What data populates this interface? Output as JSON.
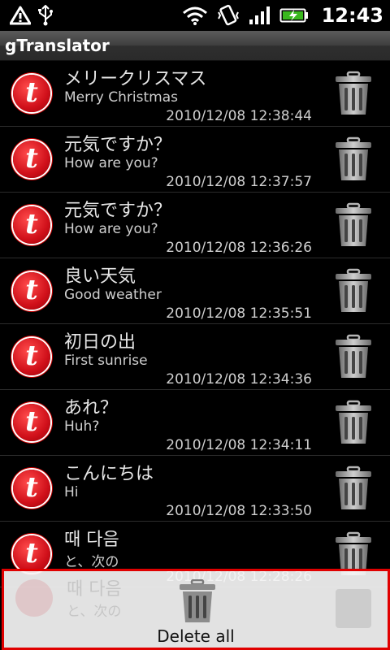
{
  "status_bar": {
    "time": "12:43",
    "icons": [
      "warning-icon",
      "usb-icon",
      "wifi-icon",
      "vibrate-icon",
      "signal-icon",
      "battery-charging-icon"
    ]
  },
  "app": {
    "title": "gTranslator"
  },
  "history": [
    {
      "source": "メリークリスマス",
      "translation": "Merry Christmas",
      "timestamp": "2010/12/08 12:38:44"
    },
    {
      "source": "元気ですか？",
      "translation": "How are you?",
      "timestamp": "2010/12/08 12:37:57"
    },
    {
      "source": "元気ですか？",
      "translation": "How are you?",
      "timestamp": "2010/12/08 12:36:26"
    },
    {
      "source": "良い天気",
      "translation": "Good weather",
      "timestamp": "2010/12/08 12:35:51"
    },
    {
      "source": "初日の出",
      "translation": "First sunrise",
      "timestamp": "2010/12/08 12:34:36"
    },
    {
      "source": "あれ？",
      "translation": "Huh?",
      "timestamp": "2010/12/08 12:34:11"
    },
    {
      "source": "こんにちは",
      "translation": "Hi",
      "timestamp": "2010/12/08 12:33:50"
    },
    {
      "source": "때 다음",
      "translation": "と、次の",
      "timestamp": "2010/12/08 12:28:26"
    }
  ],
  "bottom_bar": {
    "delete_all_label": "Delete all"
  },
  "colors": {
    "highlight_border": "#e00000",
    "avatar_red": "#d0101a"
  }
}
